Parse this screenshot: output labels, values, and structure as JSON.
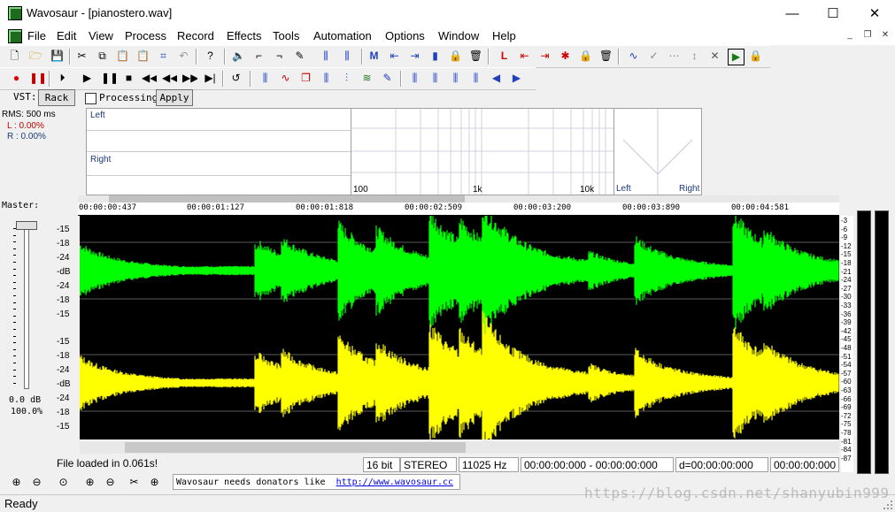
{
  "window": {
    "title": "Wavosaur - [pianostero.wav]",
    "minimize": "—",
    "maximize": "☐",
    "close": "✕"
  },
  "menu": {
    "items": [
      "File",
      "Edit",
      "View",
      "Process",
      "Record",
      "Effects",
      "Tools",
      "Automation",
      "Options",
      "Window",
      "Help"
    ],
    "mdi_min": "_",
    "mdi_restore": "❐",
    "mdi_close": "✕"
  },
  "vst": {
    "label": "VST:",
    "rack_button": "Rack",
    "processing_label": "Processing",
    "processing_checked": false,
    "apply_button": "Apply"
  },
  "meters": {
    "rms_label": "RMS: 500 ms",
    "left_value": "L : 0.00%",
    "right_value": "R : 0.00%",
    "panel_left_label": "Left",
    "panel_right_label": "Right",
    "freq_labels": [
      "100",
      "1k",
      "10k"
    ],
    "phase_left": "Left",
    "phase_right": "Right"
  },
  "timeline": {
    "labels": [
      "00:00:00:437",
      "00:00:01:127",
      "00:00:01:818",
      "00:00:02:509",
      "00:00:03:200",
      "00:00:03:890",
      "00:00:04:581"
    ]
  },
  "master": {
    "label": "Master:",
    "db_value": "0.0 dB",
    "percent": "100.0%",
    "level": 1.0
  },
  "channel_db_labels": [
    "-15",
    "-18",
    "-24",
    "-dB",
    "-24",
    "-18",
    "-15"
  ],
  "vu_scale": [
    "-3",
    "-6",
    "-9",
    "-12",
    "-15",
    "-18",
    "-21",
    "-24",
    "-27",
    "-30",
    "-33",
    "-36",
    "-39",
    "-42",
    "-45",
    "-48",
    "-51",
    "-54",
    "-57",
    "-60",
    "-63",
    "-66",
    "-69",
    "-72",
    "-75",
    "-78",
    "-81",
    "-84",
    "-87"
  ],
  "colors": {
    "left_channel": "#00ff00",
    "right_channel": "#ffff00",
    "waveform_bg": "#000000"
  },
  "status": {
    "message": "File loaded in 0.061s!",
    "bit_depth": "16 bit",
    "channels": "STEREO",
    "sample_rate": "11025 Hz",
    "selection": "00:00:00:000 - 00:00:00:000",
    "duration": "d=00:00:00:000",
    "cursor": "00:00:00:000"
  },
  "marquee": {
    "text": "Wavosaur needs donators like",
    "link": "http://www.wavosaur.cc"
  },
  "statusbar": {
    "ready": "Ready"
  },
  "watermark": "https://blog.csdn.net/shanyubin999"
}
